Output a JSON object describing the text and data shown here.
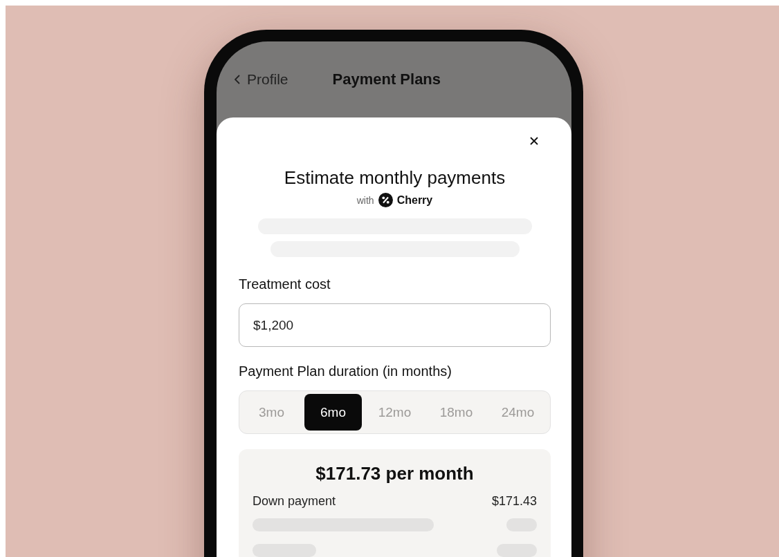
{
  "nav": {
    "back_label": "Profile",
    "title": "Payment Plans"
  },
  "modal": {
    "title": "Estimate monthly payments",
    "provider_prefix": "with",
    "provider_name": "Cherry",
    "treatment_cost": {
      "label": "Treatment cost",
      "value": "$1,200"
    },
    "duration": {
      "label": "Payment Plan duration (in months)",
      "options": [
        {
          "label": "3mo",
          "selected": false
        },
        {
          "label": "6mo",
          "selected": true
        },
        {
          "label": "12mo",
          "selected": false
        },
        {
          "label": "18mo",
          "selected": false
        },
        {
          "label": "24mo",
          "selected": false
        }
      ]
    },
    "estimate": {
      "monthly": "$171.73 per month",
      "rows": [
        {
          "label": "Down payment",
          "value": "$171.43"
        }
      ]
    }
  }
}
